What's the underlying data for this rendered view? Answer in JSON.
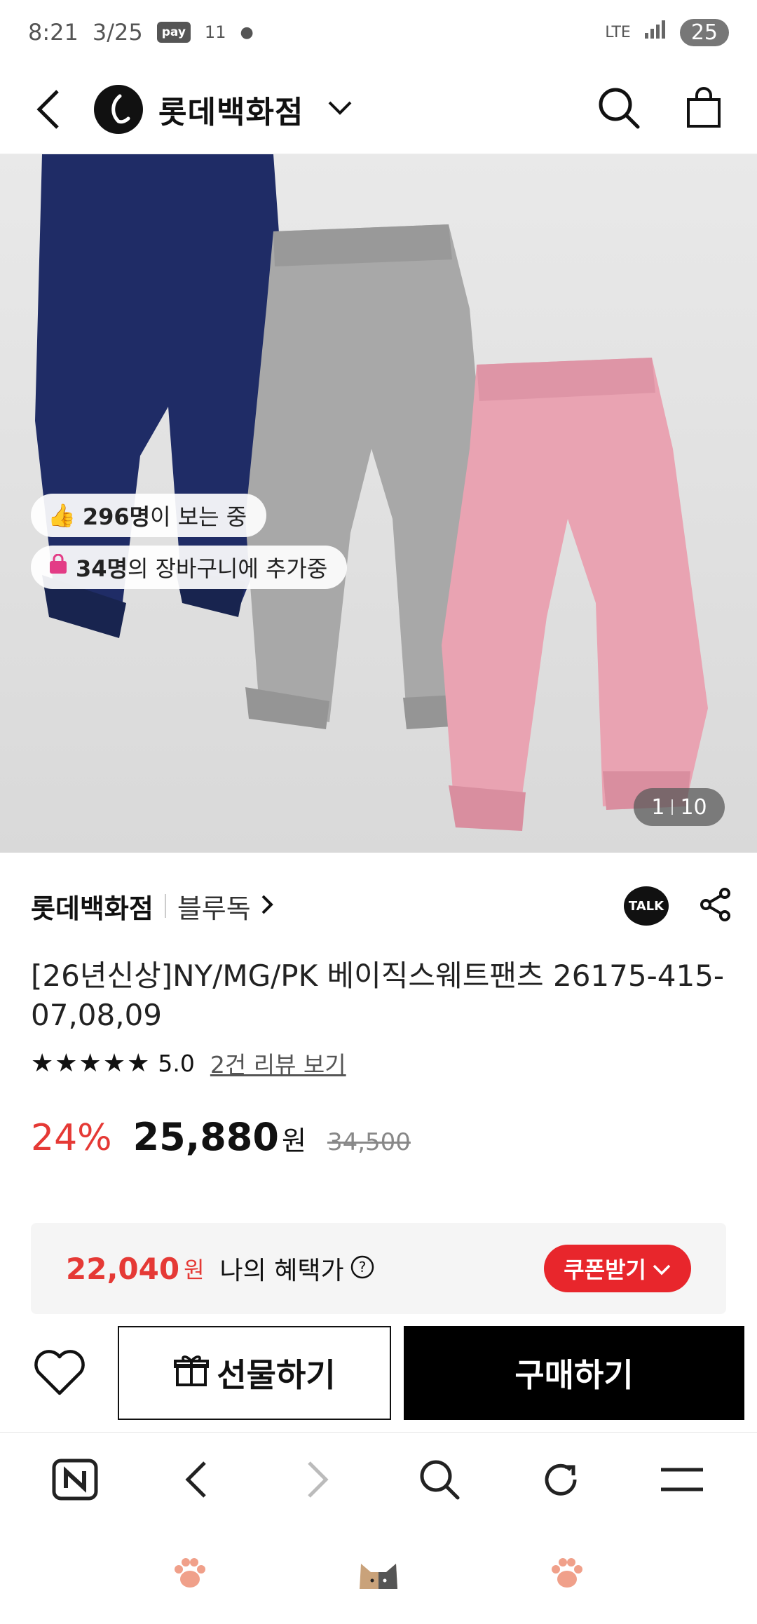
{
  "status_bar": {
    "time": "8:21",
    "date": "3/25",
    "pay_badge": "pay",
    "indicator": "11",
    "network": "LTE",
    "battery": "25"
  },
  "header": {
    "brand_name": "롯데백화점"
  },
  "hero": {
    "viewers_count": "296명",
    "viewers_text": "이 보는 중",
    "cart_count": "34명",
    "cart_text": "의 장바구니에 추가중",
    "pager_current": "1",
    "pager_total": "10"
  },
  "product": {
    "seller": "롯데백화점",
    "brand": "블루독",
    "talk_label": "TALK",
    "title": "[26년신상]NY/MG/PK 베이직스웨트팬츠 26175-415-07,08,09",
    "stars": "★★★★★",
    "rating": "5.0",
    "review_link": "2건 리뷰 보기",
    "discount": "24%",
    "price": "25,880",
    "price_unit": "원",
    "original_price": "34,500"
  },
  "benefit": {
    "price": "22,040",
    "unit": "원",
    "label": "나의 혜택가",
    "coupon_button": "쿠폰받기"
  },
  "actions": {
    "gift_label": "선물하기",
    "buy_label": "구매하기"
  },
  "colors": {
    "accent_red": "#e53935",
    "coupon_red": "#e8262c",
    "black": "#000000"
  },
  "icons": [
    "back-icon",
    "chevron-down-icon",
    "search-icon",
    "shopping-bag-icon",
    "share-icon",
    "heart-icon",
    "gift-icon",
    "naver-icon",
    "forward-icon",
    "refresh-icon",
    "menu-icon",
    "paw-icon",
    "cat-icon"
  ]
}
